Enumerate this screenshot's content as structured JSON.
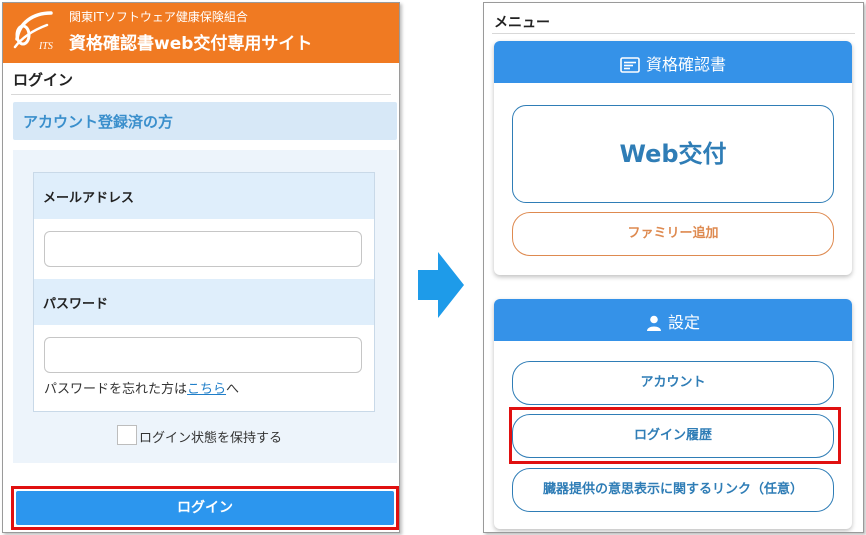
{
  "left": {
    "header": {
      "logo_text": "ITS",
      "org_name": "関東ITソフトウェア健康保険組合",
      "site_title": "資格確認書web交付専用サイト"
    },
    "login_heading": "ログイン",
    "section_title": "アカウント登録済の方",
    "form": {
      "email_label": "メールアドレス",
      "email_value": "",
      "password_label": "パスワード",
      "password_value": "",
      "forgot_prefix": "パスワードを忘れた方は",
      "forgot_link": "こちら",
      "forgot_suffix": "へ",
      "remember_label": "ログイン状態を保持する",
      "remember_checked": false
    },
    "login_button": "ログイン"
  },
  "right": {
    "menu_heading": "メニュー",
    "certificate_card": {
      "title": "資格確認書",
      "icon": "id-card-icon",
      "web_button": "Web交付",
      "family_button": "ファミリー追加"
    },
    "settings_card": {
      "title": "設定",
      "icon": "person-icon",
      "account_button": "アカウント",
      "login_history_button": "ログイン履歴",
      "organ_link_button": "臓器提供の意思表示に関するリンク（任意）"
    }
  },
  "colors": {
    "header_orange": "#f07a22",
    "primary_blue": "#2c96ee",
    "card_header_blue": "#3592e8",
    "highlight_red": "#e01010",
    "outline_blue": "#2f7db6",
    "outline_orange": "#de8a50",
    "arrow_blue": "#1e9be9"
  }
}
